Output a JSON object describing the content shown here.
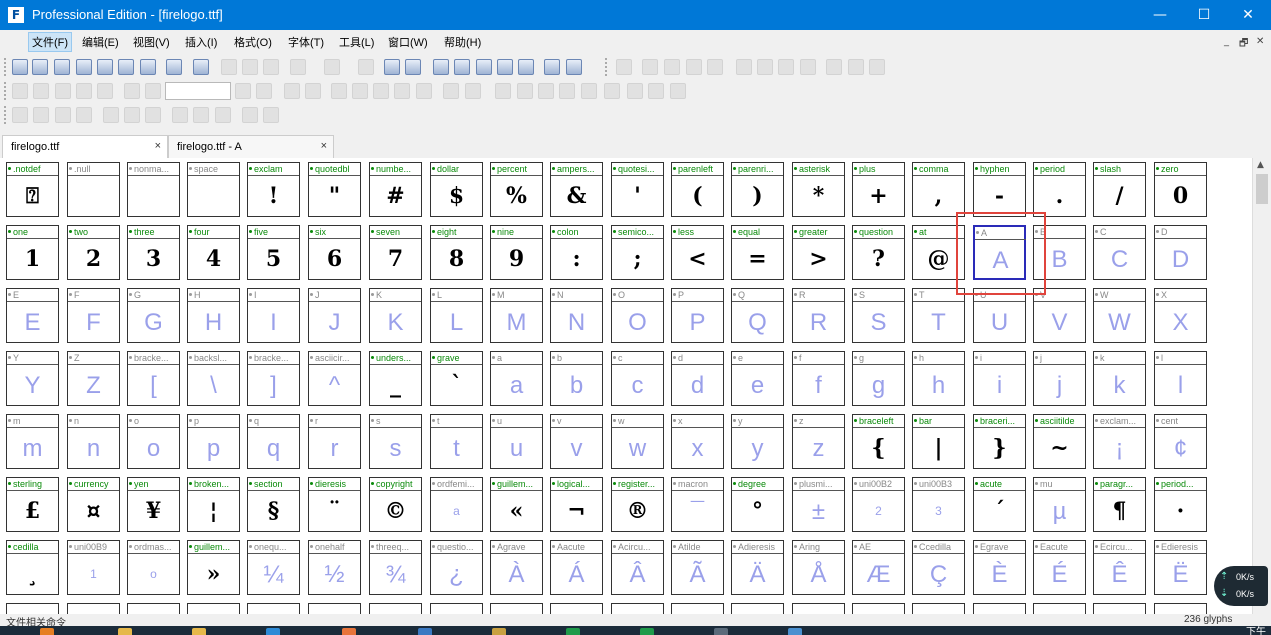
{
  "window": {
    "app_icon": "F",
    "title": "Professional Edition - [firelogo.ttf]",
    "buttons": {
      "minimize": "—",
      "maximize": "☐",
      "close": "✕"
    }
  },
  "menu": [
    "文件(F)",
    "编辑(E)",
    "视图(V)",
    "插入(I)",
    "格式(O)",
    "字体(T)",
    "工具(L)",
    "窗口(W)",
    "帮助(H)"
  ],
  "mdi_buttons": [
    "_",
    "🗗",
    "✕"
  ],
  "tabs": [
    {
      "label": "firelogo.ttf",
      "close": "×"
    },
    {
      "label": "firelogo.ttf - A",
      "close": "×"
    }
  ],
  "glyph_grid": {
    "rows": [
      [
        {
          "n": ".notdef",
          "g": "⍰",
          "d": true
        },
        {
          "n": ".null",
          "g": "",
          "d": false
        },
        {
          "n": "nonma...",
          "g": "",
          "d": false
        },
        {
          "n": "space",
          "g": "",
          "d": false
        },
        {
          "n": "exclam",
          "g": "!",
          "d": true
        },
        {
          "n": "quotedbl",
          "g": "\"",
          "d": true
        },
        {
          "n": "numbe...",
          "g": "#",
          "d": true
        },
        {
          "n": "dollar",
          "g": "$",
          "d": true
        },
        {
          "n": "percent",
          "g": "%",
          "d": true
        },
        {
          "n": "ampers...",
          "g": "&",
          "d": true
        },
        {
          "n": "quotesi...",
          "g": "'",
          "d": true
        },
        {
          "n": "parenleft",
          "g": "(",
          "d": true
        },
        {
          "n": "parenri...",
          "g": ")",
          "d": true
        },
        {
          "n": "asterisk",
          "g": "*",
          "d": true
        },
        {
          "n": "plus",
          "g": "+",
          "d": true
        },
        {
          "n": "comma",
          "g": ",",
          "d": true
        },
        {
          "n": "hyphen",
          "g": "-",
          "d": true
        },
        {
          "n": "period",
          "g": ".",
          "d": true
        },
        {
          "n": "slash",
          "g": "/",
          "d": true
        },
        {
          "n": "zero",
          "g": "0",
          "d": true
        }
      ],
      [
        {
          "n": "one",
          "g": "1",
          "d": true
        },
        {
          "n": "two",
          "g": "2",
          "d": true
        },
        {
          "n": "three",
          "g": "3",
          "d": true
        },
        {
          "n": "four",
          "g": "4",
          "d": true
        },
        {
          "n": "five",
          "g": "5",
          "d": true
        },
        {
          "n": "six",
          "g": "6",
          "d": true
        },
        {
          "n": "seven",
          "g": "7",
          "d": true
        },
        {
          "n": "eight",
          "g": "8",
          "d": true
        },
        {
          "n": "nine",
          "g": "9",
          "d": true
        },
        {
          "n": "colon",
          "g": ":",
          "d": true
        },
        {
          "n": "semico...",
          "g": ";",
          "d": true
        },
        {
          "n": "less",
          "g": "<",
          "d": true
        },
        {
          "n": "equal",
          "g": "=",
          "d": true
        },
        {
          "n": "greater",
          "g": ">",
          "d": true
        },
        {
          "n": "question",
          "g": "?",
          "d": true
        },
        {
          "n": "at",
          "g": "@",
          "d": true
        },
        {
          "n": "A",
          "g": "A",
          "d": false,
          "sel": true
        },
        {
          "n": "B",
          "g": "B",
          "d": false
        },
        {
          "n": "C",
          "g": "C",
          "d": false
        },
        {
          "n": "D",
          "g": "D",
          "d": false
        }
      ],
      [
        {
          "n": "E",
          "g": "E",
          "d": false
        },
        {
          "n": "F",
          "g": "F",
          "d": false
        },
        {
          "n": "G",
          "g": "G",
          "d": false
        },
        {
          "n": "H",
          "g": "H",
          "d": false
        },
        {
          "n": "I",
          "g": "I",
          "d": false
        },
        {
          "n": "J",
          "g": "J",
          "d": false
        },
        {
          "n": "K",
          "g": "K",
          "d": false
        },
        {
          "n": "L",
          "g": "L",
          "d": false
        },
        {
          "n": "M",
          "g": "M",
          "d": false
        },
        {
          "n": "N",
          "g": "N",
          "d": false
        },
        {
          "n": "O",
          "g": "O",
          "d": false
        },
        {
          "n": "P",
          "g": "P",
          "d": false
        },
        {
          "n": "Q",
          "g": "Q",
          "d": false
        },
        {
          "n": "R",
          "g": "R",
          "d": false
        },
        {
          "n": "S",
          "g": "S",
          "d": false
        },
        {
          "n": "T",
          "g": "T",
          "d": false
        },
        {
          "n": "U",
          "g": "U",
          "d": false
        },
        {
          "n": "V",
          "g": "V",
          "d": false
        },
        {
          "n": "W",
          "g": "W",
          "d": false
        },
        {
          "n": "X",
          "g": "X",
          "d": false
        }
      ],
      [
        {
          "n": "Y",
          "g": "Y",
          "d": false
        },
        {
          "n": "Z",
          "g": "Z",
          "d": false
        },
        {
          "n": "bracke...",
          "g": "[",
          "d": false
        },
        {
          "n": "backsl...",
          "g": "\\",
          "d": false
        },
        {
          "n": "bracke...",
          "g": "]",
          "d": false
        },
        {
          "n": "asciicir...",
          "g": "^",
          "d": false
        },
        {
          "n": "unders...",
          "g": "_",
          "d": true
        },
        {
          "n": "grave",
          "g": "`",
          "d": true
        },
        {
          "n": "a",
          "g": "a",
          "d": false
        },
        {
          "n": "b",
          "g": "b",
          "d": false
        },
        {
          "n": "c",
          "g": "c",
          "d": false
        },
        {
          "n": "d",
          "g": "d",
          "d": false
        },
        {
          "n": "e",
          "g": "e",
          "d": false
        },
        {
          "n": "f",
          "g": "f",
          "d": false
        },
        {
          "n": "g",
          "g": "g",
          "d": false
        },
        {
          "n": "h",
          "g": "h",
          "d": false
        },
        {
          "n": "i",
          "g": "i",
          "d": false
        },
        {
          "n": "j",
          "g": "j",
          "d": false
        },
        {
          "n": "k",
          "g": "k",
          "d": false
        },
        {
          "n": "l",
          "g": "l",
          "d": false
        }
      ],
      [
        {
          "n": "m",
          "g": "m",
          "d": false
        },
        {
          "n": "n",
          "g": "n",
          "d": false
        },
        {
          "n": "o",
          "g": "o",
          "d": false
        },
        {
          "n": "p",
          "g": "p",
          "d": false
        },
        {
          "n": "q",
          "g": "q",
          "d": false
        },
        {
          "n": "r",
          "g": "r",
          "d": false
        },
        {
          "n": "s",
          "g": "s",
          "d": false
        },
        {
          "n": "t",
          "g": "t",
          "d": false
        },
        {
          "n": "u",
          "g": "u",
          "d": false
        },
        {
          "n": "v",
          "g": "v",
          "d": false
        },
        {
          "n": "w",
          "g": "w",
          "d": false
        },
        {
          "n": "x",
          "g": "x",
          "d": false
        },
        {
          "n": "y",
          "g": "y",
          "d": false
        },
        {
          "n": "z",
          "g": "z",
          "d": false
        },
        {
          "n": "braceleft",
          "g": "{",
          "d": true
        },
        {
          "n": "bar",
          "g": "|",
          "d": true
        },
        {
          "n": "braceri...",
          "g": "}",
          "d": true
        },
        {
          "n": "asciitilde",
          "g": "~",
          "d": true
        },
        {
          "n": "exclam...",
          "g": "¡",
          "d": false
        },
        {
          "n": "cent",
          "g": "¢",
          "d": false
        }
      ],
      [
        {
          "n": "sterling",
          "g": "£",
          "d": true
        },
        {
          "n": "currency",
          "g": "¤",
          "d": true
        },
        {
          "n": "yen",
          "g": "¥",
          "d": true
        },
        {
          "n": "broken...",
          "g": "¦",
          "d": true
        },
        {
          "n": "section",
          "g": "§",
          "d": true
        },
        {
          "n": "dieresis",
          "g": "¨",
          "d": true
        },
        {
          "n": "copyright",
          "g": "©",
          "d": true
        },
        {
          "n": "ordfemi...",
          "g": "a",
          "d": false,
          "s": "tiny"
        },
        {
          "n": "guillem...",
          "g": "«",
          "d": true
        },
        {
          "n": "logical...",
          "g": "¬",
          "d": true
        },
        {
          "n": "register...",
          "g": "®",
          "d": true
        },
        {
          "n": "macron",
          "g": "¯",
          "d": false
        },
        {
          "n": "degree",
          "g": "°",
          "d": true
        },
        {
          "n": "plusmi...",
          "g": "±",
          "d": false
        },
        {
          "n": "uni00B2",
          "g": "2",
          "d": false,
          "s": "tiny"
        },
        {
          "n": "uni00B3",
          "g": "3",
          "d": false,
          "s": "tiny"
        },
        {
          "n": "acute",
          "g": "´",
          "d": true
        },
        {
          "n": "mu",
          "g": "µ",
          "d": false
        },
        {
          "n": "paragr...",
          "g": "¶",
          "d": true
        },
        {
          "n": "period...",
          "g": "·",
          "d": true
        }
      ],
      [
        {
          "n": "cedilla",
          "g": "¸",
          "d": true
        },
        {
          "n": "uni00B9",
          "g": "1",
          "d": false,
          "s": "tiny"
        },
        {
          "n": "ordmas...",
          "g": "o",
          "d": false,
          "s": "tiny"
        },
        {
          "n": "guillem...",
          "g": "»",
          "d": true
        },
        {
          "n": "onequ...",
          "g": "¼",
          "d": false
        },
        {
          "n": "onehalf",
          "g": "½",
          "d": false
        },
        {
          "n": "threeq...",
          "g": "¾",
          "d": false
        },
        {
          "n": "questio...",
          "g": "¿",
          "d": false
        },
        {
          "n": "Agrave",
          "g": "À",
          "d": false
        },
        {
          "n": "Aacute",
          "g": "Á",
          "d": false
        },
        {
          "n": "Acircu...",
          "g": "Â",
          "d": false
        },
        {
          "n": "Atilde",
          "g": "Ã",
          "d": false
        },
        {
          "n": "Adieresis",
          "g": "Ä",
          "d": false
        },
        {
          "n": "Aring",
          "g": "Å",
          "d": false
        },
        {
          "n": "AE",
          "g": "Æ",
          "d": false
        },
        {
          "n": "Ccedilla",
          "g": "Ç",
          "d": false
        },
        {
          "n": "Egrave",
          "g": "È",
          "d": false
        },
        {
          "n": "Eacute",
          "g": "É",
          "d": false
        },
        {
          "n": "Ecircu...",
          "g": "Ê",
          "d": false
        },
        {
          "n": "Edieresis",
          "g": "Ë",
          "d": false
        }
      ]
    ]
  },
  "status": {
    "text": "文件相关命令",
    "glyph_count": "236 glyphs"
  },
  "netmon": {
    "up": "0K/s",
    "down": "0K/s"
  },
  "taskbar": {
    "clock": "下午"
  },
  "colors": {
    "titlebar": "#0078d7",
    "defined_label": "#0a8a0a",
    "undefined_glyph": "#9aa0ea",
    "highlight": "#e0443c",
    "selection": "#2a2ab8"
  }
}
